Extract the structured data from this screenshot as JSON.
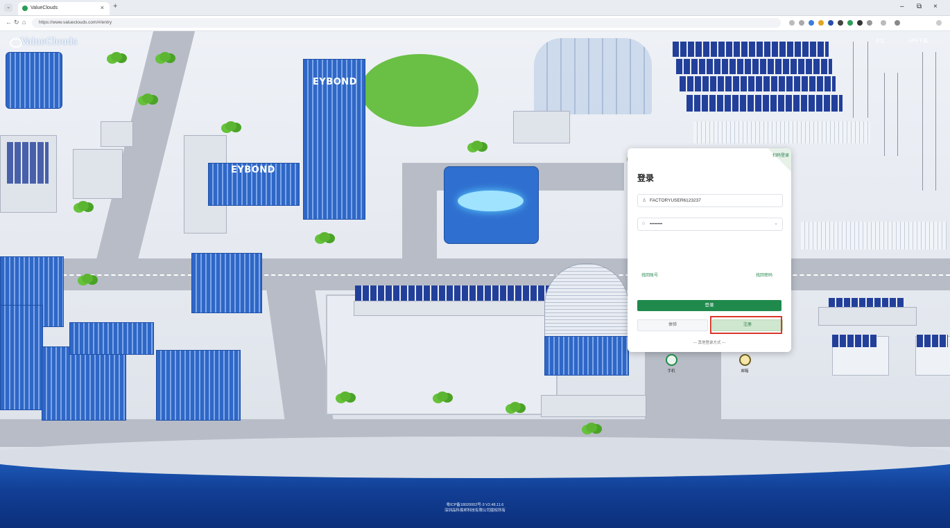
{
  "browser": {
    "tab_title": "ValueClouds",
    "tab_close": "×",
    "new_tab": "+",
    "url": "https://www.valueclouds.com/#/entry",
    "win_min": "–",
    "win_max": "⧉",
    "win_close": "×"
  },
  "page": {
    "logo_text": "ValueClouds",
    "top_right_lang": "中文",
    "top_right_download": "APP下载",
    "building_sign_1": "EYBOND",
    "building_sign_2": "EYBOND",
    "footer_line1": "粤ICP备18020002号-3 V2.48.11.6",
    "footer_line2": "深圳品科易邦科技有限公司版权所有"
  },
  "login": {
    "corner_text": "扫码登录",
    "title": "登录",
    "username_value": "FACTORYUSER6123237",
    "password_value": "••••••••",
    "register_link": "找回账号",
    "forgot_link": "找回密码",
    "login_button": "登录",
    "experience_button": "体验",
    "register_button": "注册",
    "other_methods": "— 其他登录方式 —",
    "alt_phone": "手机",
    "alt_email": "邮箱"
  }
}
